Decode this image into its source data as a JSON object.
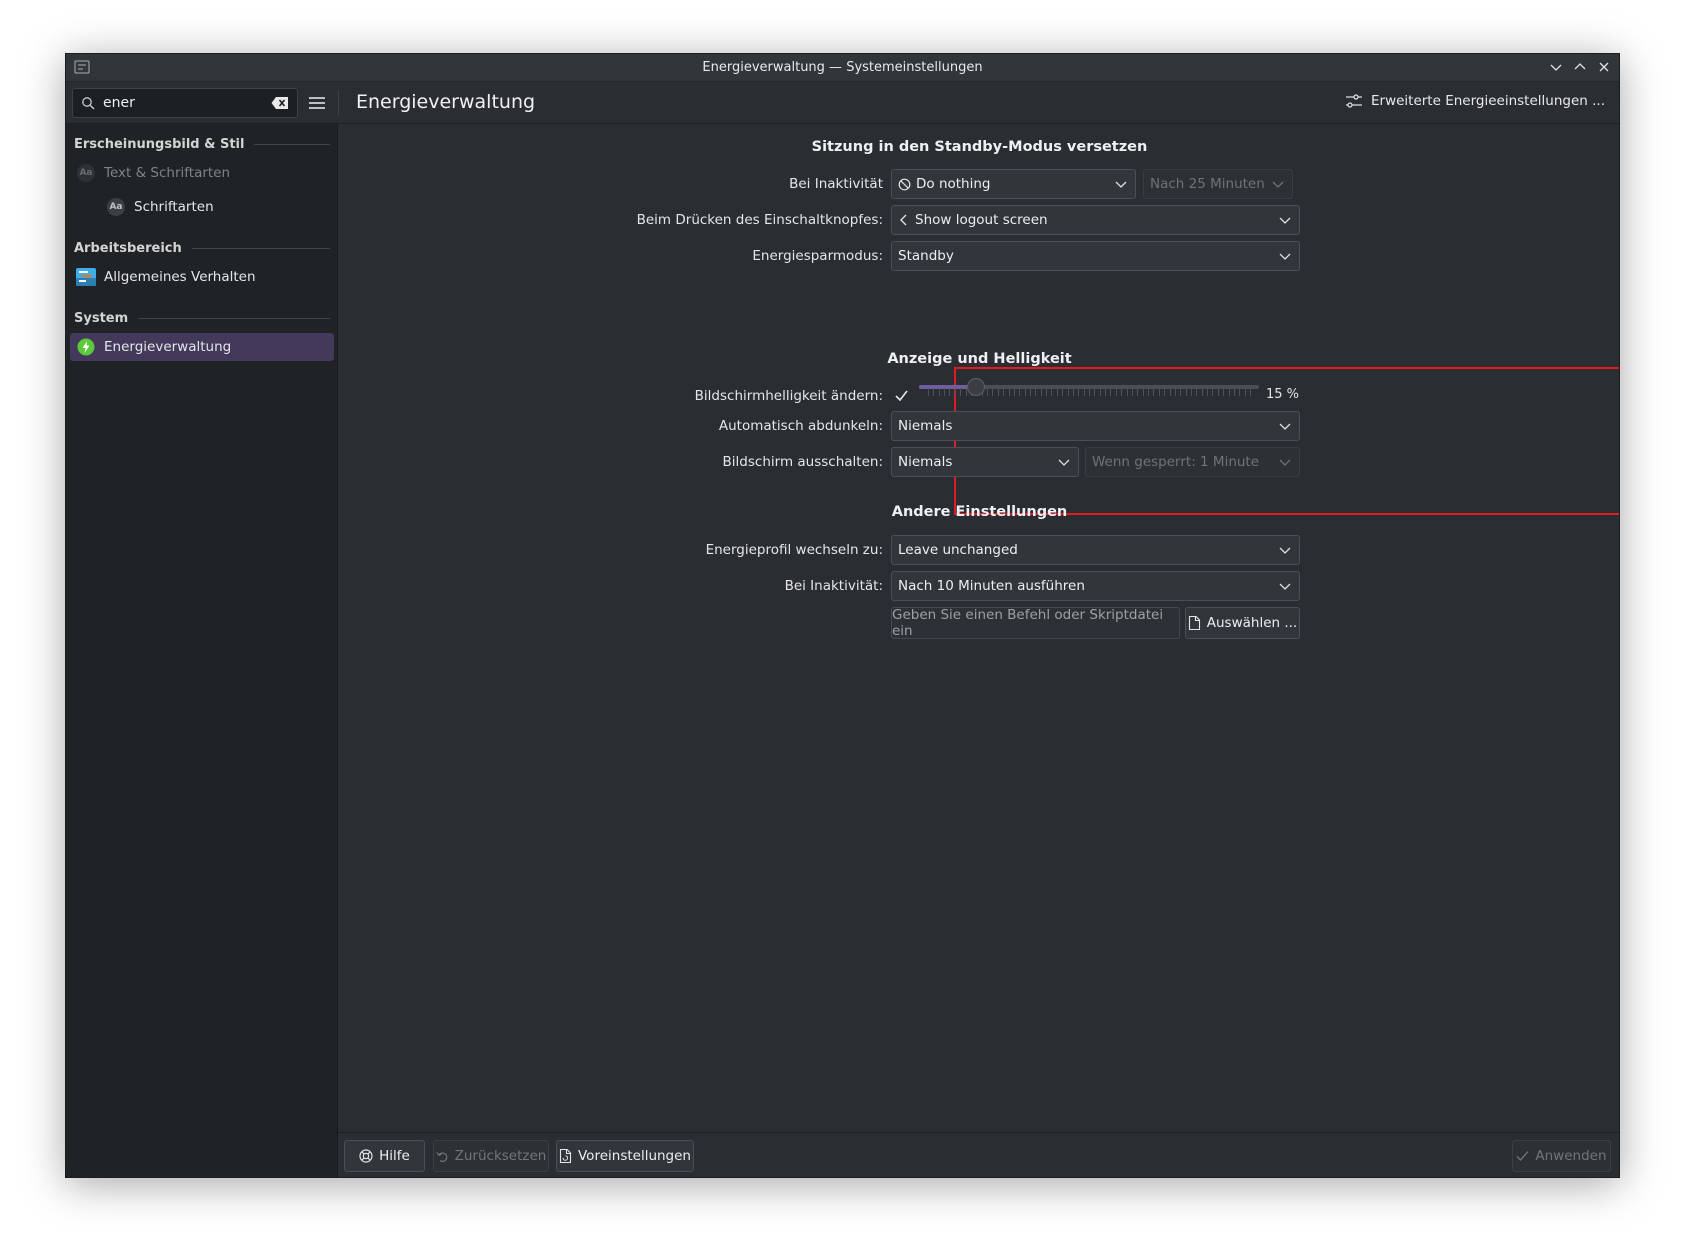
{
  "window": {
    "title": "Energieverwaltung — Systemeinstellungen"
  },
  "toolbar": {
    "search_value": "ener",
    "page_title": "Energieverwaltung",
    "advanced_label": "Erweiterte Energieeinstellungen ..."
  },
  "sidebar": {
    "groups": [
      {
        "title": "Erscheinungsbild & Stil",
        "items": [
          {
            "label": "Text & Schriftarten",
            "icon": "font-icon",
            "state": "dimmed"
          },
          {
            "label": "Schriftarten",
            "icon": "font-icon",
            "state": "normal"
          }
        ]
      },
      {
        "title": "Arbeitsbereich",
        "items": [
          {
            "label": "Allgemeines Verhalten",
            "icon": "general-behavior-icon",
            "state": "normal"
          }
        ]
      },
      {
        "title": "System",
        "items": [
          {
            "label": "Energieverwaltung",
            "icon": "power-icon",
            "state": "selected"
          }
        ]
      }
    ]
  },
  "suspend": {
    "title": "Sitzung in den Standby-Modus versetzen",
    "inactivity_label": "Bei Inaktivität",
    "inactivity_value": "Do nothing",
    "inactivity_delay": "Nach 25 Minuten",
    "power_button_label": "Beim Drücken des Einschaltknopfes:",
    "power_button_value": "Show logout screen",
    "sleep_mode_label": "Energiesparmodus:",
    "sleep_mode_value": "Standby"
  },
  "display": {
    "title": "Anzeige und Helligkeit",
    "brightness_label": "Bildschirmhelligkeit ändern:",
    "brightness_value": "15 %",
    "brightness_level": 0.15,
    "dim_label": "Automatisch abdunkeln:",
    "dim_value": "Niemals",
    "screen_off_label": "Bildschirm ausschalten:",
    "screen_off_value": "Niemals",
    "screen_off_locked": "Wenn gesperrt: 1 Minute"
  },
  "other": {
    "title": "Andere Einstellungen",
    "profile_label": "Energieprofil wechseln zu:",
    "profile_value": "Leave unchanged",
    "inactivity_label": "Bei Inaktivität:",
    "inactivity_value": "Nach 10 Minuten ausführen",
    "script_placeholder": "Geben Sie einen Befehl oder Skriptdatei ein",
    "choose_label": "Auswählen ..."
  },
  "footer": {
    "help": "Hilfe",
    "reset": "Zurücksetzen",
    "defaults": "Voreinstellungen",
    "apply": "Anwenden"
  },
  "colors": {
    "accent": "#433a5b",
    "highlight": "#e01b24",
    "power_icon": "#5cc93b"
  }
}
